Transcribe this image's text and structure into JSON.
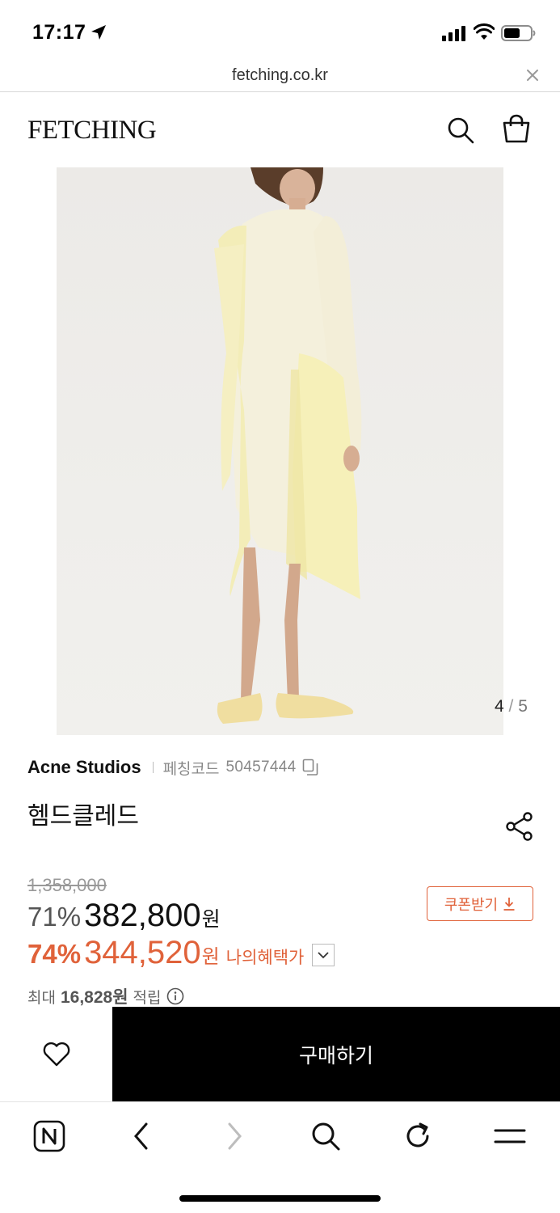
{
  "status_bar": {
    "time": "17:17",
    "icons": [
      "location-arrow-icon",
      "signal-icon",
      "wifi-icon",
      "battery-icon"
    ]
  },
  "browser": {
    "url": "fetching.co.kr",
    "close_icon": "close-icon"
  },
  "header": {
    "logo": "FETCHING",
    "icons": [
      "search-icon",
      "shopping-bag-icon"
    ]
  },
  "gallery": {
    "current": "4",
    "separator": "/",
    "total": "5"
  },
  "product": {
    "brand": "Acne Studios",
    "code_label": "페칭코드",
    "code": "50457444",
    "name": "헴드클레드"
  },
  "pricing": {
    "original_price": "1,358,000",
    "discount_rate": "71%",
    "sale_price": "382,800",
    "currency": "원",
    "benefit_rate": "74%",
    "benefit_price": "344,520",
    "benefit_label": "나의혜택가",
    "coupon_label": "쿠폰받기",
    "points_prefix": "최대",
    "points_value": "16,828원",
    "points_suffix": "적립"
  },
  "actions": {
    "buy_label": "구매하기",
    "wishlist_icon": "heart-icon"
  },
  "browser_toolbar": {
    "icons": [
      "naver-home-icon",
      "back-icon",
      "forward-icon",
      "search-icon",
      "refresh-icon",
      "menu-icon"
    ]
  },
  "colors": {
    "accent": "#e0623a",
    "buy_button": "#000000",
    "text": "#111111",
    "muted": "#888888"
  }
}
